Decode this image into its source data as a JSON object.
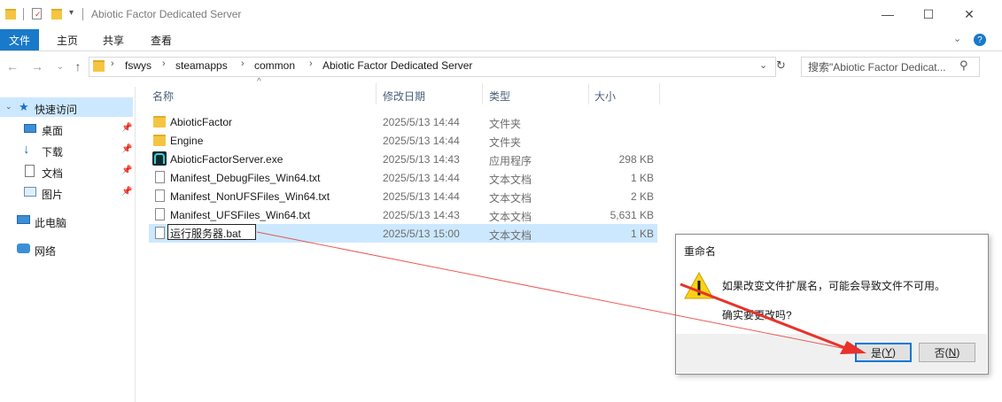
{
  "window": {
    "title": "Abiotic Factor Dedicated Server",
    "controls": {
      "minimize": "—",
      "maximize": "☐",
      "close": "✕"
    }
  },
  "ribbon": {
    "tabs": [
      {
        "label": "文件",
        "active": true
      },
      {
        "label": "主页"
      },
      {
        "label": "共享"
      },
      {
        "label": "查看"
      }
    ]
  },
  "address": {
    "crumbs": [
      "fswys",
      "steamapps",
      "common",
      "Abiotic Factor Dedicated Server"
    ],
    "search_placeholder": "搜索\"Abiotic Factor Dedicat..."
  },
  "nav": {
    "items": [
      {
        "label": "快速访问",
        "icon": "star-icon",
        "selected": true
      },
      {
        "label": "桌面",
        "icon": "desktop-icon",
        "pinned": true
      },
      {
        "label": "下载",
        "icon": "download-icon",
        "pinned": true
      },
      {
        "label": "文档",
        "icon": "document-icon",
        "pinned": true
      },
      {
        "label": "图片",
        "icon": "picture-icon",
        "pinned": true
      },
      {
        "label": "此电脑",
        "icon": "computer-icon"
      },
      {
        "label": "网络",
        "icon": "network-icon"
      }
    ]
  },
  "table": {
    "headers": {
      "name": "名称",
      "date": "修改日期",
      "type": "类型",
      "size": "大小"
    },
    "rows": [
      {
        "name": "AbioticFactor",
        "date": "2025/5/13 14:44",
        "type": "文件夹",
        "size": "",
        "icon": "folder-icon"
      },
      {
        "name": "Engine",
        "date": "2025/5/13 14:44",
        "type": "文件夹",
        "size": "",
        "icon": "folder-icon"
      },
      {
        "name": "AbioticFactorServer.exe",
        "date": "2025/5/13 14:43",
        "type": "应用程序",
        "size": "298 KB",
        "icon": "exe-icon"
      },
      {
        "name": "Manifest_DebugFiles_Win64.txt",
        "date": "2025/5/13 14:44",
        "type": "文本文档",
        "size": "1 KB",
        "icon": "text-file-icon"
      },
      {
        "name": "Manifest_NonUFSFiles_Win64.txt",
        "date": "2025/5/13 14:44",
        "type": "文本文档",
        "size": "2 KB",
        "icon": "text-file-icon"
      },
      {
        "name": "Manifest_UFSFiles_Win64.txt",
        "date": "2025/5/13 14:43",
        "type": "文本文档",
        "size": "5,631 KB",
        "icon": "text-file-icon"
      },
      {
        "name": "运行服务器.bat",
        "date": "2025/5/13 15:00",
        "type": "文本文档",
        "size": "1 KB",
        "icon": "text-file-icon",
        "selected": true,
        "renaming": true
      }
    ]
  },
  "dialog": {
    "title": "重命名",
    "message": "如果改变文件扩展名，可能会导致文件不可用。",
    "question": "确实要更改吗?",
    "yes_label": "是",
    "yes_key": "Y",
    "no_label": "否",
    "no_key": "N"
  },
  "colors": {
    "accent": "#1979ca",
    "selection": "#cce8ff",
    "annotation": "#e8322b"
  }
}
